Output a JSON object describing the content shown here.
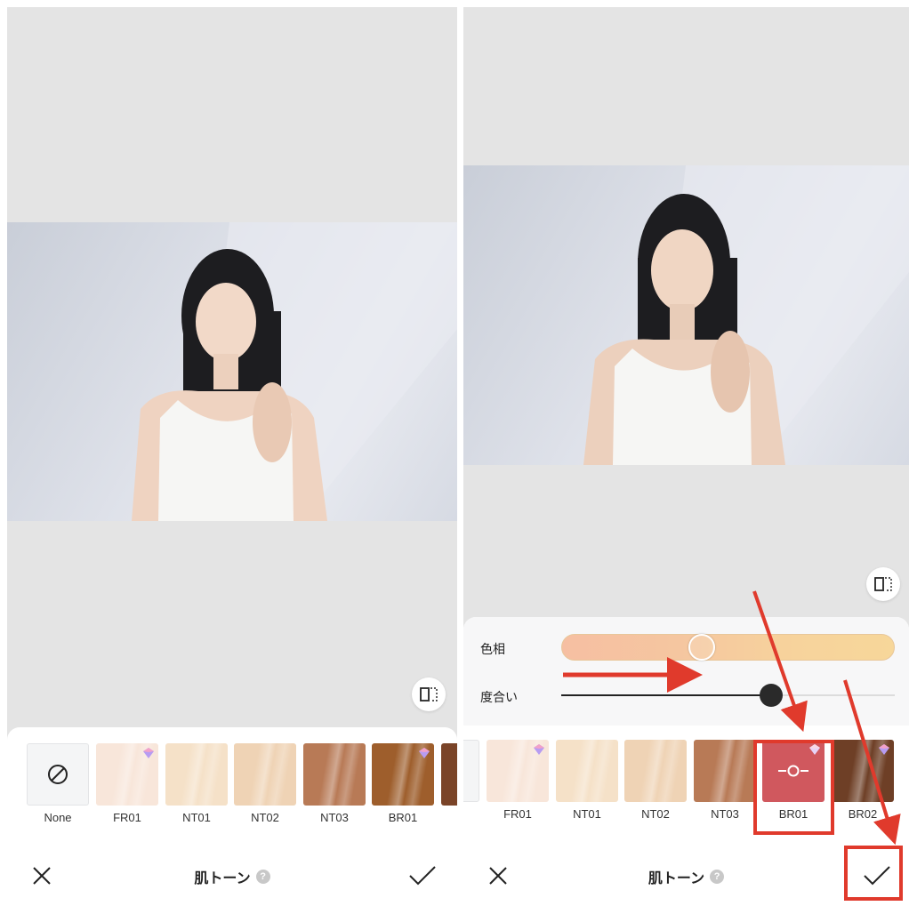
{
  "screens": [
    {
      "id": "left",
      "toolbar": {
        "close_icon": "close-icon",
        "title": "肌トーン",
        "help": "?",
        "apply_icon": "check-icon"
      },
      "presets": [
        {
          "label": "None",
          "color": "#f4f5f6",
          "type": "none",
          "premium": false
        },
        {
          "label": "FR01",
          "color": "#f8e6da",
          "premium": true
        },
        {
          "label": "NT01",
          "color": "#f5e1c8",
          "premium": false
        },
        {
          "label": "NT02",
          "color": "#efd3b5",
          "premium": false
        },
        {
          "label": "NT03",
          "color": "#b87a56",
          "premium": false
        },
        {
          "label": "BR01",
          "color": "#9e5e2c",
          "premium": true
        },
        {
          "label": "",
          "color": "#7a4428",
          "premium": false
        }
      ]
    },
    {
      "id": "right",
      "adjust": {
        "hue_label": "色相",
        "degree_label": "度合い",
        "hue_value": 0.42,
        "degree_value": 0.63
      },
      "toolbar": {
        "close_icon": "close-icon",
        "title": "肌トーン",
        "help": "?",
        "apply_icon": "check-icon"
      },
      "presets": [
        {
          "label": "",
          "color": "#f4f5f6",
          "type": "none",
          "premium": false
        },
        {
          "label": "FR01",
          "color": "#f8e6da",
          "premium": true
        },
        {
          "label": "NT01",
          "color": "#f5e1c8",
          "premium": false
        },
        {
          "label": "NT02",
          "color": "#efd3b5",
          "premium": false
        },
        {
          "label": "NT03",
          "color": "#b87a56",
          "premium": false
        },
        {
          "label": "BR01",
          "color": "#d0585e",
          "premium": true,
          "selected": true
        },
        {
          "label": "BR02",
          "color": "#6e3f26",
          "premium": true
        }
      ]
    }
  ],
  "colors": {
    "annotation": "#e03a2c"
  }
}
